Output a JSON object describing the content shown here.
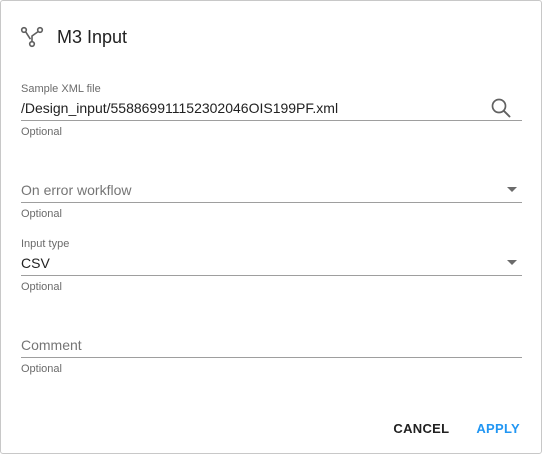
{
  "dialog": {
    "title": "M3 Input",
    "icon": "workflow-branch-icon"
  },
  "fields": {
    "sample_xml": {
      "label": "Sample XML file",
      "value": "/Design_input/558869911152302046OIS199PF.xml",
      "hint": "Optional",
      "icon": "search-icon"
    },
    "on_error_workflow": {
      "placeholder": "On error workflow",
      "value": "",
      "hint": "Optional",
      "icon": "chevron-down-icon"
    },
    "input_type": {
      "label": "Input type",
      "value": "CSV",
      "hint": "Optional",
      "icon": "chevron-down-icon"
    },
    "comment": {
      "placeholder": "Comment",
      "value": "",
      "hint": "Optional"
    }
  },
  "actions": {
    "cancel_label": "CANCEL",
    "apply_label": "APPLY"
  },
  "colors": {
    "accent": "#2196f3",
    "text": "#212121",
    "secondary_text": "#6b6b6b",
    "underline": "#9e9e9e"
  }
}
